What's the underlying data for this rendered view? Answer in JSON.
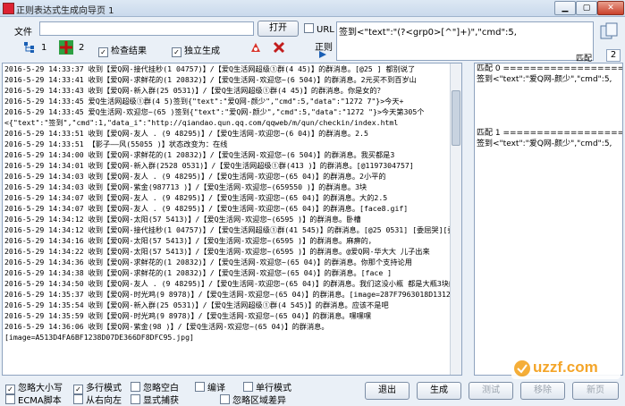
{
  "window": {
    "title": "正则表达式生成向导页 1"
  },
  "file": {
    "label": "文件",
    "value": "",
    "open_label": "打开"
  },
  "url": {
    "label": "URL",
    "checked": false
  },
  "regex": {
    "label": "正则",
    "value": "签到<\"text\":\"(?<grp0>[^\"]+)\",\"cmd\":5,"
  },
  "toolbar": {
    "count1": "1",
    "count2": "2",
    "check_result": "检查结果",
    "standalone": "独立生成"
  },
  "match_mode": {
    "label": "匹配",
    "value": "2"
  },
  "log_lines": [
    "2016-5-29 14:33:37 收到【爱Q网-接代挂秒(1     04757)】/【爱Q生活网超级①群(4     45)】的群消息。[@25     ] 都别说了",
    "2016-5-29 14:33:41 收到【爱Q网-求鲜花的(1     20832)】/【爱Q生活网-欢迎您~(6     504)】的群消息。2元买不到百岁山",
    "2016-5-29 14:33:43 收到【爱Q网-新入群(25     0531)】/【爱Q生活网超级①群(4     45)】的群消息。你是女的？",
    "2016-5-29 14:33:45 爱Q生活网超级①群(4     5)签到{\"text\":\"爱Q网-颜少\",\"cmd\":5,\"data\":\"1272     7\"}>今天+",
    "2016-5-29 14:33:45 爱Q生活网-欢迎您~(65     )签到{\"text\":\"爱Q网-颜少\",\"cmd\":5,\"data\":\"1272     \"}>今天第305个",
    "<{\"text\":\"签到\",\"cmd\":1,\"data_i\":\"http://qiandao.qun.qq.com/qqweb/m/qun/checkin/index.html",
    "2016-5-29 14:33:51 收到【爱Q网-友人  .  (9     48295)】/【爱Q生活网-欢迎您~(6     04)】的群消息。2.5",
    "2016-5-29 14:33:51 【影子——风(55055     )】状态改变为：在线",
    "2016-5-29 14:34:00 收到【爱Q网-求鲜花的(1     20832)】/【爱Q生活网-欢迎您~(6     504)】的群消息。我买都是3",
    "2016-5-29 14:34:01 收到【爱Q网-新入群(2528     0531)】/【爱Q生活网超级①群(413     )】的群消息。[@1197304757]",
    "2016-5-29 14:34:03 收到【爱Q网-友人  .  (9     48295)】/【爱Q生活网-欢迎您~(65     04)】的群消息。2小平的",
    "2016-5-29 14:34:03 收到【爱Q网-紫金(987713     )】/【爱Q生活网-欢迎您~(659550     )】的群消息。3块",
    "2016-5-29 14:34:07 收到【爱Q网-友人  .  (9     48295)】/【爱Q生活网-欢迎您~(65     04)】的群消息。大的2.5",
    "2016-5-29 14:34:07 收到【爱Q网-友人  .  (9     48295)】/【爱Q生活网-欢迎您~(65     04)】的群消息。[face8.gif]",
    "2016-5-29 14:34:12 收到【爱Q网-太阳(57     5413)】/【爱Q生活网-欢迎您~(6595     )】的群消息。卧槽",
    "2016-5-29 14:34:12 收到【爱Q网-接代挂秒(1     04757)】/【爱Q生活网超级①群(41     545)】的群消息。[@25     0531] [委屈哭][委屈哭]",
    "2016-5-29 14:34:16 收到【爱Q网-太阳(57     5413)】/【爱Q生活网-欢迎您~(6595     )】的群消息。麻痹的，",
    "2016-5-29 14:34:22 收到【爱Q网-太阳(57     5413)】/【爱Q生活网-欢迎您~(6595     )】的群消息。@爱Q网-华大大 儿子出来",
    "2016-5-29 14:34:36 收到【爱Q网-求鲜花的(1     20832)】/【爱Q生活网-欢迎您~(65     04)】的群消息。你那个支持论用",
    "2016-5-29 14:34:38 收到【爱Q网-求鲜花的(1     20832)】/【爱Q生活网-欢迎您~(65     04)】的群消息。[face     ]",
    "2016-5-29 14:34:50 收到【爱Q网-友人  .  (9     48295)】/【爱Q生活网-欢迎您~(65     04)】的群消息。我们这没小瓶  都是大瓶3块的",
    "2016-5-29 14:35:37 收到【爱Q网-时光鸡(9     8978)】/【爱Q生活网-欢迎您~(65     04)】的群消息。[image=287F7963018D1312D7525B6FC29E5AF5.png]",
    "2016-5-29 14:35:54 收到【爱Q网-新入群(25     0531)】/【爱Q生活网超级①群(4     545)】的群消息。应该不是吧",
    "2016-5-29 14:35:59 收到【爱Q网-时光鸡(9     8978)】/【爱Q生活网-欢迎您~(65     04)】的群消息。嘿嘿嘿",
    "2016-5-29 14:36:06 收到【爱Q网-紫金(98     )】/【爱Q生活网-欢迎您~(65     04)】的群消息。",
    "[image=A513D4FA6BF1238D07DE366DF8DFC95.jpg]"
  ],
  "match_lines": [
    "匹配 0 ===================",
    "签到<\"text\":\"爱Q网-颜少\",\"cmd\":5,",
    "",
    "",
    "",
    "",
    "匹配 1 ===================",
    "签到<\"text\":\"爱Q网-颜少\",\"cmd\":5,"
  ],
  "options": {
    "ignore_case": "忽略大小写",
    "multiline": "多行模式",
    "ignore_space": "忽略空白",
    "compile": "编译",
    "singleline": "单行模式",
    "ecma": "ECMA脚本",
    "right_to_left": "从右向左",
    "explicit_capture": "显式捕获",
    "ignore_area_diff": "忽略区域差异"
  },
  "buttons": {
    "exit": "退出",
    "generate": "生成",
    "test": "测试",
    "remove": "移除",
    "new_page": "新页"
  },
  "watermark": "uzzf.com",
  "colors": {
    "accent": "#1a5fb4",
    "window_bg": "#eaf0f7"
  }
}
